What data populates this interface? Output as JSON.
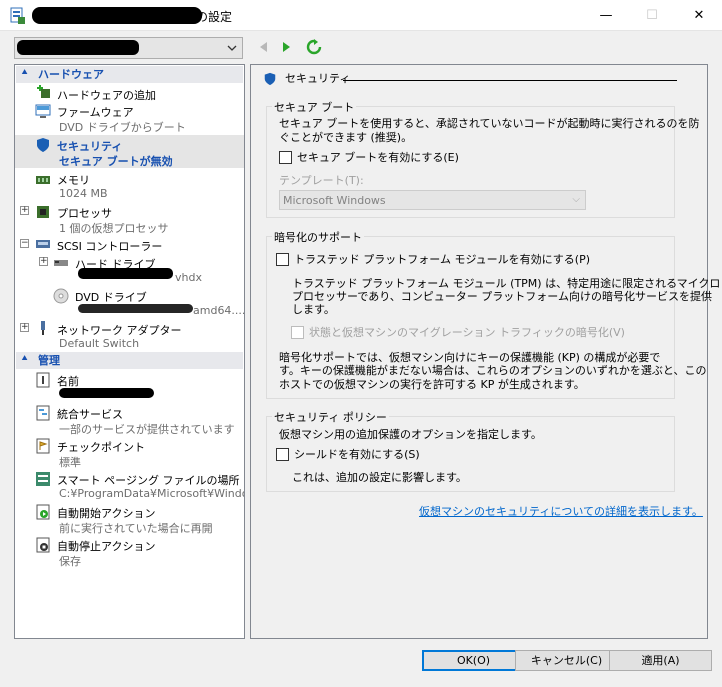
{
  "window": {
    "title": "の設定",
    "minimize": "—",
    "maximize": "☐",
    "close": "✕"
  },
  "vm_selector": {
    "value": ""
  },
  "toolbar": {
    "back_icon": "back-arrow-icon",
    "forward_icon": "forward-arrow-icon",
    "refresh_icon": "refresh-icon"
  },
  "sidebar": {
    "hardware_header": "ハードウェア",
    "management_header": "管理",
    "hardware": [
      {
        "label": "ハードウェアの追加",
        "sub": ""
      },
      {
        "label": "ファームウェア",
        "sub": "DVD ドライブからブート"
      },
      {
        "label": "セキュリティ",
        "sub": "セキュア ブートが無効"
      },
      {
        "label": "メモリ",
        "sub": "1024 MB"
      },
      {
        "label": "プロセッサ",
        "sub": "1 個の仮想プロセッサ"
      },
      {
        "label": "SCSI コントローラー",
        "sub": ""
      },
      {
        "label": "ハード ドライブ",
        "sub": "vhdx"
      },
      {
        "label": "DVD ドライブ",
        "sub": "amd64...."
      },
      {
        "label": "ネットワーク アダプター",
        "sub": "Default Switch"
      }
    ],
    "management": [
      {
        "label": "名前",
        "sub": ""
      },
      {
        "label": "統合サービス",
        "sub": "一部のサービスが提供されています"
      },
      {
        "label": "チェックポイント",
        "sub": "標準"
      },
      {
        "label": "スマート ページング ファイルの場所",
        "sub": "C:¥ProgramData¥Microsoft¥Windo..."
      },
      {
        "label": "自動開始アクション",
        "sub": "前に実行されていた場合に再開"
      },
      {
        "label": "自動停止アクション",
        "sub": "保存"
      }
    ]
  },
  "main": {
    "title": "セキュリティ",
    "secure_boot": {
      "group_title": "セキュア ブート",
      "desc_line1": "セキュア ブートを使用すると、承認されていないコードが起動時に実行されるのを防",
      "desc_line2": "ぐことができます (推奨)。",
      "checkbox_label": "セキュア ブートを有効にする(E)",
      "checked": false,
      "template_label": "テンプレート(T):",
      "template_value": "Microsoft Windows"
    },
    "encryption": {
      "group_title": "暗号化のサポート",
      "tpm_checkbox_label": "トラステッド プラットフォーム モジュールを有効にする(P)",
      "tpm_checked": false,
      "tpm_desc_line1": "トラステッド プラットフォーム モジュール (TPM) は、特定用途に限定されるマイクロ",
      "tpm_desc_line2": "プロセッサーであり、コンピューター プラットフォーム向けの暗号化サービスを提供",
      "tpm_desc_line3": "します。",
      "traffic_checkbox_label": "状態と仮想マシンのマイグレーション トラフィックの暗号化(V)",
      "traffic_checked": false,
      "kp_line1": "暗号化サポートでは、仮想マシン向けにキーの保護機能 (KP) の構成が必要で",
      "kp_line2": "す。キーの保護機能がまだない場合は、これらのオプションのいずれかを選ぶと、この",
      "kp_line3": "ホストでの仮想マシンの実行を許可する KP が生成されます。"
    },
    "policy": {
      "group_title": "セキュリティ ポリシー",
      "desc": "仮想マシン用の追加保護のオプションを指定します。",
      "shield_checkbox_label": "シールドを有効にする(S)",
      "shield_checked": false,
      "note": "これは、追加の設定に影響します。"
    },
    "link": "仮想マシンのセキュリティについての詳細を表示します。"
  },
  "buttons": {
    "ok": "OK(O)",
    "cancel": "キャンセル(C)",
    "apply": "適用(A)"
  }
}
